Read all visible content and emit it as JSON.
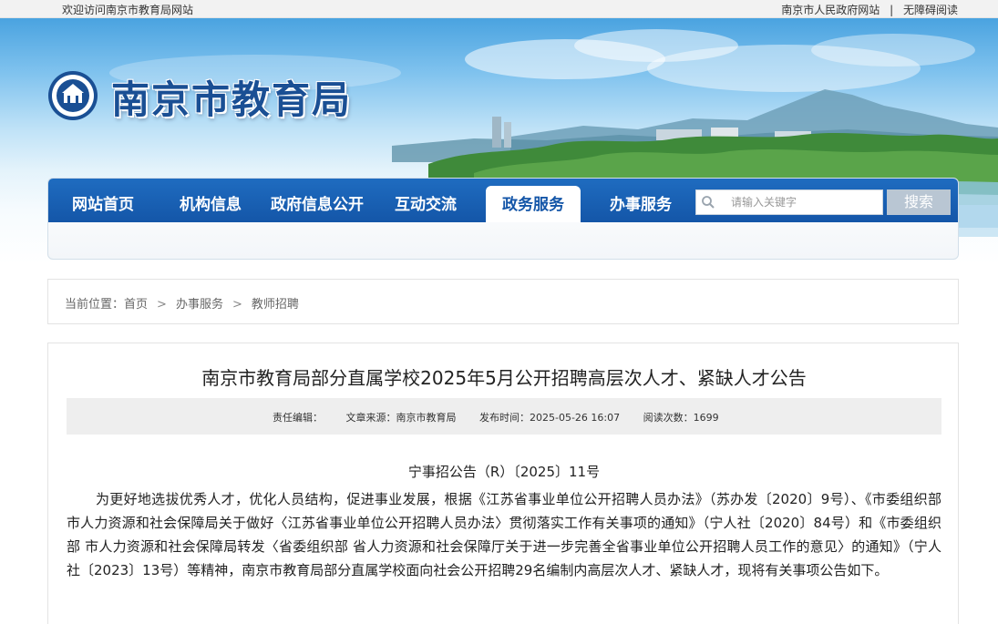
{
  "topbar": {
    "welcome": "欢迎访问南京市教育局网站",
    "gov_link": "南京市人民政府网站",
    "separator": "|",
    "accessibility": "无障碍阅读"
  },
  "header": {
    "site_name": "南京市教育局"
  },
  "nav": {
    "items": [
      "网站首页",
      "机构信息",
      "政府信息公开",
      "互动交流",
      "政务服务",
      "办事服务"
    ],
    "active": "政务服务",
    "search_placeholder": "请输入关键字",
    "search_button": "搜索"
  },
  "breadcrumb": {
    "prefix": "当前位置：",
    "items": [
      "首页",
      "办事服务",
      "教师招聘"
    ]
  },
  "article": {
    "title": "南京市教育局部分直属学校2025年5月公开招聘高层次人才、紧缺人才公告",
    "meta": {
      "editor": "责任编辑：",
      "source": "文章来源：南京市教育局",
      "date": "发布时间：2025-05-26 16:07",
      "views": "阅读次数：1699"
    },
    "doc_number": "宁事招公告（R）〔2025〕11号",
    "paragraph": "为更好地选拔优秀人才，优化人员结构，促进事业发展，根据《江苏省事业单位公开招聘人员办法》（苏办发〔2020〕9号）、《市委组织部 市人力资源和社会保障局关于做好〈江苏省事业单位公开招聘人员办法〉贯彻落实工作有关事项的通知》（宁人社〔2020〕84号）和《市委组织部 市人力资源和社会保障局转发〈省委组织部 省人力资源和社会保障厅关于进一步完善全省事业单位公开招聘人员工作的意见〉的通知》（宁人社〔2023〕13号）等精神，南京市教育局部分直属学校面向社会公开招聘29名编制内高层次人才、紧缺人才，现将有关事项公告如下。"
  },
  "colors": {
    "nav_blue": "#1456a8",
    "site_name_blue": "#1a4f94",
    "search_button": "#b9c6d3"
  }
}
